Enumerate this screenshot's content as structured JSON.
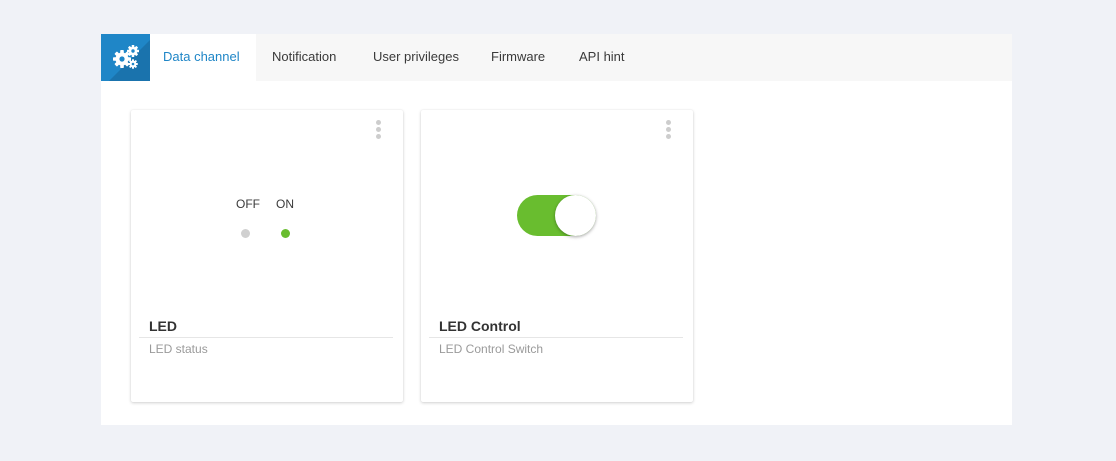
{
  "tabs": [
    {
      "label": "Data channel",
      "active": true
    },
    {
      "label": "Notification",
      "active": false
    },
    {
      "label": "User privileges",
      "active": false
    },
    {
      "label": "Firmware",
      "active": false
    },
    {
      "label": "API hint",
      "active": false
    }
  ],
  "cards": [
    {
      "title": "LED",
      "subtitle": "LED status",
      "widget": "led-indicator",
      "off_label": "OFF",
      "on_label": "ON",
      "state": "on",
      "menu_icon": "kebab-icon"
    },
    {
      "title": "LED Control",
      "subtitle": "LED Control Switch",
      "widget": "toggle-switch",
      "state": "on",
      "menu_icon": "kebab-icon"
    }
  ],
  "icons": {
    "settings": "gears-icon"
  },
  "colors": {
    "accent": "#1f86c7",
    "on_green": "#69bd2f",
    "off_gray": "#d0d0d0",
    "page_bg": "#f0f2f7"
  }
}
